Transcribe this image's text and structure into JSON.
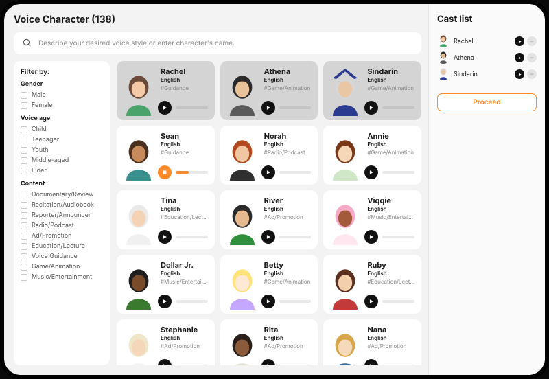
{
  "header": {
    "title": "Voice Character (138)",
    "search_placeholder": "Describe your desired voice style or enter character's name."
  },
  "filters": {
    "label": "Filter by:",
    "groups": [
      {
        "title": "Gender",
        "options": [
          "Male",
          "Female"
        ]
      },
      {
        "title": "Voice age",
        "options": [
          "Child",
          "Teenager",
          "Youth",
          "Middle-aged",
          "Elder"
        ]
      },
      {
        "title": "Content",
        "options": [
          "Documentary/Review",
          "Recitation/Audiobook",
          "Reporter/Announcer",
          "Radio/Podcast",
          "Ad/Promotion",
          "Education/Lecture",
          "Voice Guidance",
          "Game/Animation",
          "Music/Entertainment"
        ]
      }
    ]
  },
  "characters": [
    {
      "name": "Rachel",
      "lang": "English",
      "tag": "#Guidance",
      "selected": true,
      "playing": false,
      "avatar": {
        "hair": "#6d4b3a",
        "skin": "#f3c9a8",
        "shirt": "#4aa36a"
      }
    },
    {
      "name": "Athena",
      "lang": "English",
      "tag": "#Game/Animation",
      "selected": true,
      "playing": false,
      "avatar": {
        "hair": "#2a2a2a",
        "skin": "#eac29a",
        "shirt": "#5a5a5a"
      }
    },
    {
      "name": "Sindarin",
      "lang": "English",
      "tag": "#Game/Animation",
      "selected": true,
      "playing": false,
      "avatar": {
        "hair": "#d6d6d6",
        "skin": "#e9c7a5",
        "shirt": "#2b3b8f",
        "hat": "#2b3b8f"
      }
    },
    {
      "name": "Sean",
      "lang": "English",
      "tag": "#Guidance",
      "selected": false,
      "playing": true,
      "avatar": {
        "hair": "#4a2f1e",
        "skin": "#c78a5a",
        "shirt": "#3a8f8f"
      }
    },
    {
      "name": "Norah",
      "lang": "English",
      "tag": "#Radio/Podcast",
      "selected": false,
      "playing": false,
      "avatar": {
        "hair": "#b24a1f",
        "skin": "#f1c7a1",
        "shirt": "#2f2f2f"
      }
    },
    {
      "name": "Annie",
      "lang": "English",
      "tag": "#Game/Animation",
      "selected": false,
      "playing": false,
      "avatar": {
        "hair": "#7a3a1a",
        "skin": "#f6d7b8",
        "shirt": "#cfe6c7"
      }
    },
    {
      "name": "Tina",
      "lang": "English",
      "tag": "#Education/Lecture",
      "selected": false,
      "playing": false,
      "avatar": {
        "hair": "#eaeaea",
        "skin": "#f4d3b5",
        "shirt": "#f0f0f0"
      }
    },
    {
      "name": "River",
      "lang": "English",
      "tag": "#Ad/Promotion",
      "selected": false,
      "playing": false,
      "avatar": {
        "hair": "#2a2a2a",
        "skin": "#e6b98f",
        "shirt": "#2f8f3a"
      }
    },
    {
      "name": "Viqqie",
      "lang": "English",
      "tag": "#Music/Entertainment",
      "selected": false,
      "playing": false,
      "avatar": {
        "hair": "#f7a9c8",
        "skin": "#a35a3a",
        "shirt": "#ffe6ef"
      }
    },
    {
      "name": "Dollar Jr.",
      "lang": "English",
      "tag": "#Music/Entertainment",
      "selected": false,
      "playing": false,
      "avatar": {
        "hair": "#1e1e1e",
        "skin": "#7a4b2a",
        "shirt": "#3a7a2f"
      }
    },
    {
      "name": "Betty",
      "lang": "English",
      "tag": "#Game/Animation",
      "selected": false,
      "playing": false,
      "avatar": {
        "hair": "#ffe37a",
        "skin": "#ffe9d4",
        "shirt": "#c6a7ff"
      }
    },
    {
      "name": "Ruby",
      "lang": "English",
      "tag": "#Education/Lecture",
      "selected": false,
      "playing": false,
      "avatar": {
        "hair": "#5a2f1e",
        "skin": "#f3cfae",
        "shirt": "#c23a3a"
      }
    },
    {
      "name": "Stephanie",
      "lang": "English",
      "tag": "#Ad/Promotion",
      "selected": false,
      "playing": false,
      "avatar": {
        "hair": "#efe5c8",
        "skin": "#f4d6b8",
        "shirt": "#f3f3f3"
      }
    },
    {
      "name": "Rita",
      "lang": "English",
      "tag": "#Ad/Promotion",
      "selected": false,
      "playing": false,
      "avatar": {
        "hair": "#2a1e1a",
        "skin": "#8a5a3a",
        "shirt": "#e7e2d6"
      }
    },
    {
      "name": "Nana",
      "lang": "English",
      "tag": "#Ad/Promotion",
      "selected": false,
      "playing": false,
      "avatar": {
        "hair": "#d8a64a",
        "skin": "#f6d9bb",
        "shirt": "#3a6fa3"
      }
    }
  ],
  "cast": {
    "title": "Cast list",
    "items": [
      {
        "name": "Rachel",
        "avatar": {
          "hair": "#6d4b3a",
          "skin": "#f3c9a8",
          "shirt": "#4aa36a"
        }
      },
      {
        "name": "Athena",
        "avatar": {
          "hair": "#2a2a2a",
          "skin": "#eac29a",
          "shirt": "#5a5a5a"
        }
      },
      {
        "name": "Sindarin",
        "avatar": {
          "hair": "#d6d6d6",
          "skin": "#e9c7a5",
          "shirt": "#2b3b8f"
        }
      }
    ],
    "proceed_label": "Proceed"
  }
}
